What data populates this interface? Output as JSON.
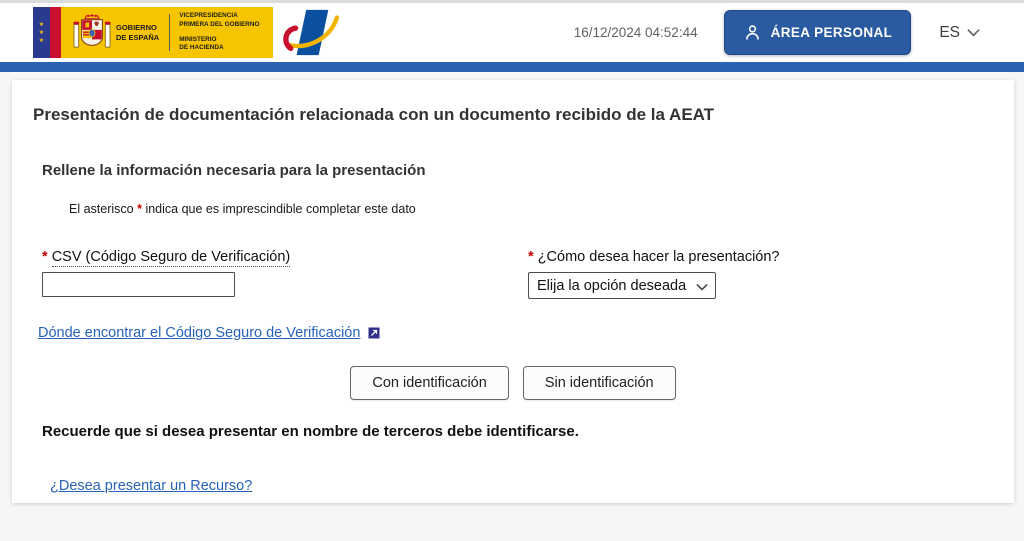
{
  "header": {
    "logo": {
      "gobierno_line1": "GOBIERNO",
      "gobierno_line2": "DE ESPAÑA",
      "vice_line1": "VICEPRESIDENCIA",
      "vice_line2": "PRIMERA DEL GOBIERNO",
      "min_line1": "MINISTERIO",
      "min_line2": "DE HACIENDA"
    },
    "datetime": "16/12/2024 04:52:44",
    "area_personal_label": "ÁREA PERSONAL",
    "language": "ES"
  },
  "main": {
    "title": "Presentación de documentación relacionada con un documento recibido de la AEAT",
    "subtitle": "Rellene la información necesaria para la presentación",
    "asterisk": "*",
    "note_prefix": "El asterisco",
    "note_suffix": "indica que es imprescindible completar este dato",
    "csv_label": "CSV (Código Seguro de Verificación)",
    "csv_value": "",
    "presentation_label": "¿Cómo desea hacer la presentación?",
    "presentation_selected": "Elija la opción deseada",
    "csv_help_link": "Dónde encontrar el Código Seguro de Verificación",
    "buttons": {
      "with_id": "Con identificación",
      "without_id": "Sin identificación"
    },
    "reminder": "Recuerde que si desea presentar en nombre de terceros debe identificarse.",
    "recurso_link": "¿Desea presentar un Recurso?"
  },
  "icons": {
    "person": "person-icon",
    "chevron_down": "chevron-down-icon",
    "external_link": "external-link-icon"
  },
  "colors": {
    "accent_bar_blue": "#2b63b0",
    "area_personal_blue": "#2a5a9f",
    "link_blue": "#2862b8",
    "logo_yellow": "#F6C500",
    "logo_red": "#C8102E",
    "logo_eu_blue": "#2a3b8f",
    "aeat_blue": "#0b50a0",
    "asterisk_red": "#cc0000",
    "page_background": "#f6f6f7"
  }
}
